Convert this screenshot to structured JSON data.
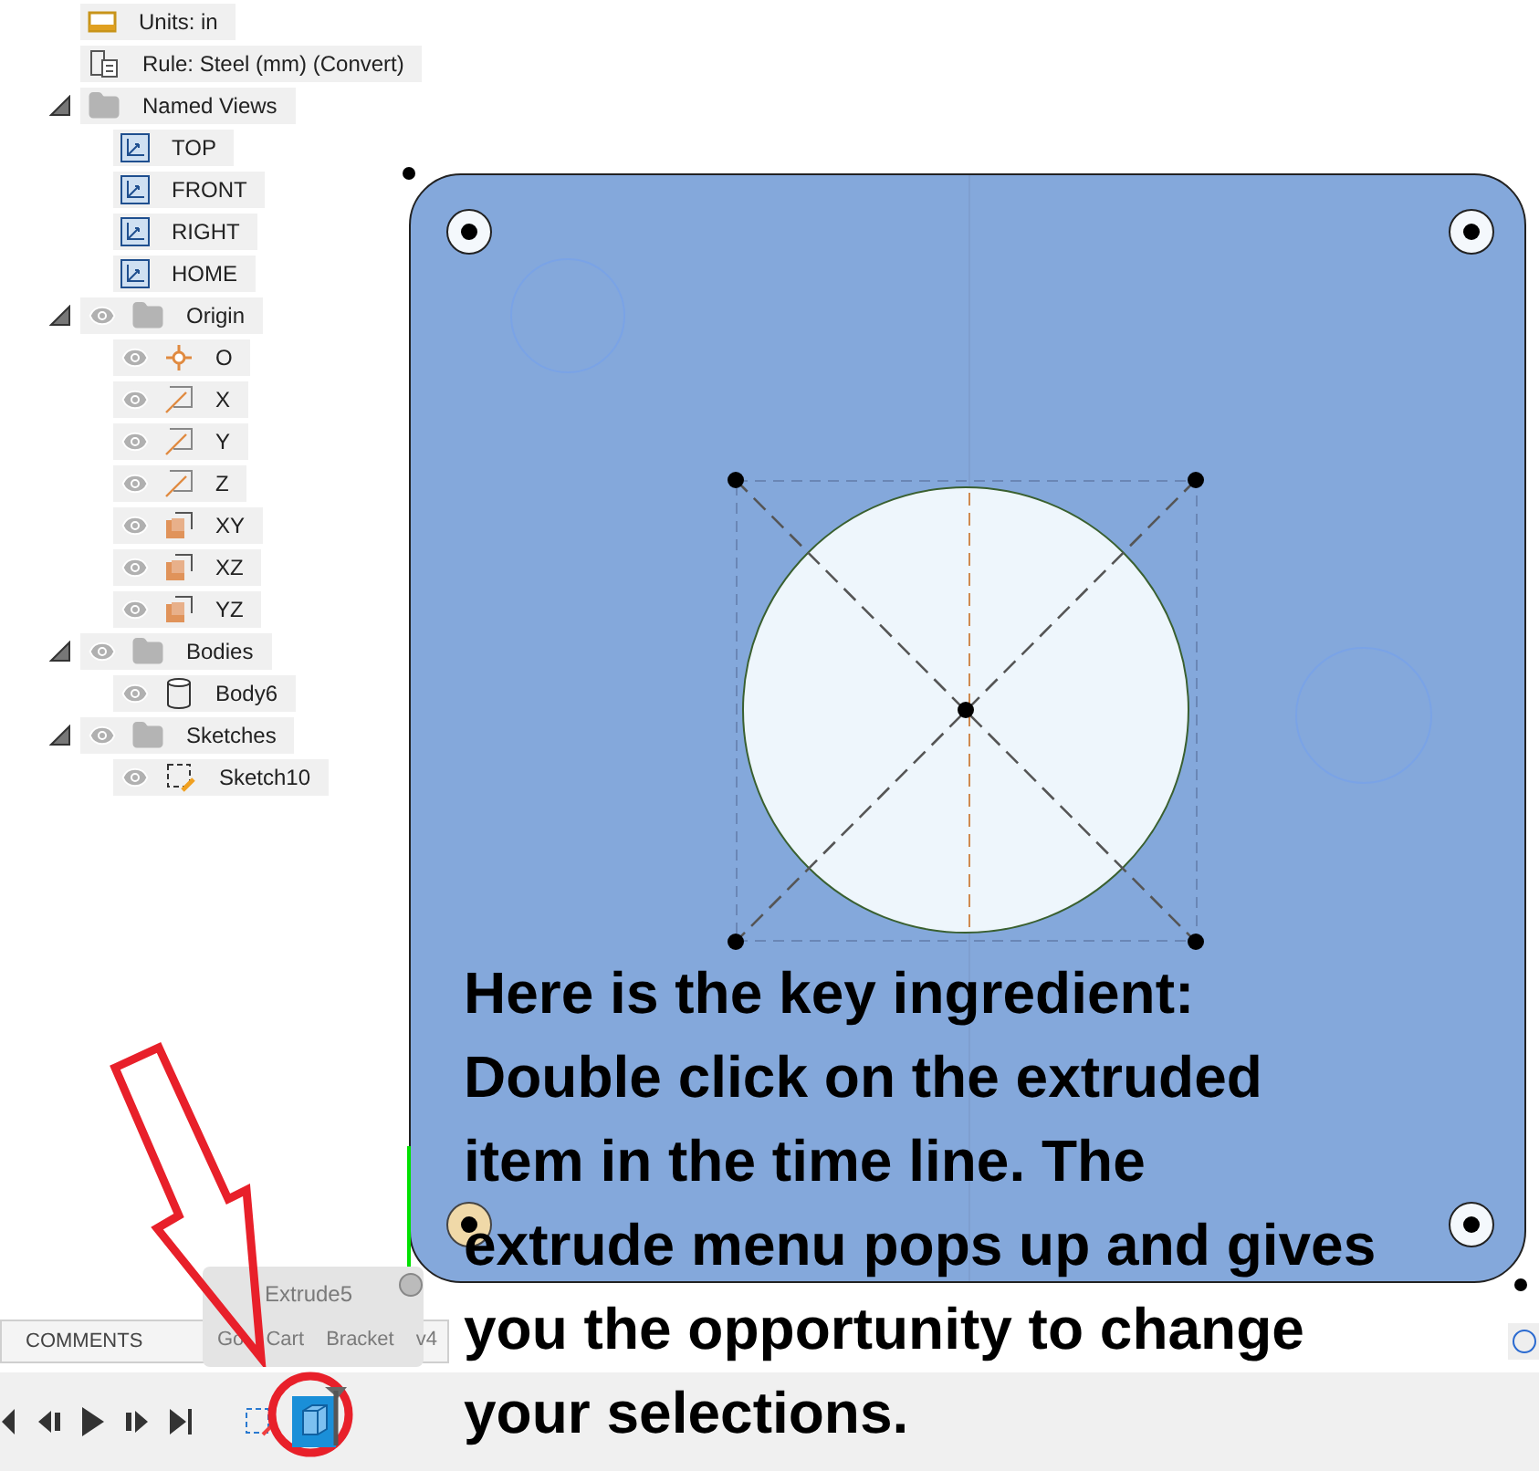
{
  "browser": {
    "items": [
      {
        "kind": "units",
        "label": "Units: in"
      },
      {
        "kind": "rule",
        "label": "Rule: Steel (mm) (Convert)"
      },
      {
        "kind": "folder",
        "label": "Named Views",
        "expanded": true,
        "children": [
          {
            "kind": "view",
            "label": "TOP"
          },
          {
            "kind": "view",
            "label": "FRONT"
          },
          {
            "kind": "view",
            "label": "RIGHT"
          },
          {
            "kind": "view",
            "label": "HOME"
          }
        ]
      },
      {
        "kind": "folder",
        "label": "Origin",
        "expanded": true,
        "visible": true,
        "children": [
          {
            "kind": "point",
            "label": "O",
            "visible": true
          },
          {
            "kind": "axis",
            "label": "X",
            "visible": true
          },
          {
            "kind": "axis",
            "label": "Y",
            "visible": true
          },
          {
            "kind": "axis",
            "label": "Z",
            "visible": true
          },
          {
            "kind": "plane",
            "label": "XY",
            "visible": true
          },
          {
            "kind": "plane",
            "label": "XZ",
            "visible": true
          },
          {
            "kind": "plane",
            "label": "YZ",
            "visible": true
          }
        ]
      },
      {
        "kind": "folder",
        "label": "Bodies",
        "expanded": true,
        "visible": true,
        "children": [
          {
            "kind": "body",
            "label": "Body6",
            "visible": true
          }
        ]
      },
      {
        "kind": "folder",
        "label": "Sketches",
        "expanded": true,
        "visible": true,
        "children": [
          {
            "kind": "sketch",
            "label": "Sketch10",
            "visible": true
          }
        ]
      }
    ]
  },
  "comments": {
    "label": "COMMENTS"
  },
  "tooltip": {
    "title": "Extrude5",
    "subtitle": "Go Cart Bracket v4"
  },
  "timeline": {
    "items": [
      {
        "kind": "sketch",
        "selected": false
      },
      {
        "kind": "extrude",
        "selected": true
      }
    ]
  },
  "annotation": {
    "lines": [
      "Here is the key ingredient:",
      "Double click on the extruded",
      "item in the time line. The",
      "extrude menu pops up and gives",
      "you the opportunity to change",
      "your selections."
    ]
  }
}
